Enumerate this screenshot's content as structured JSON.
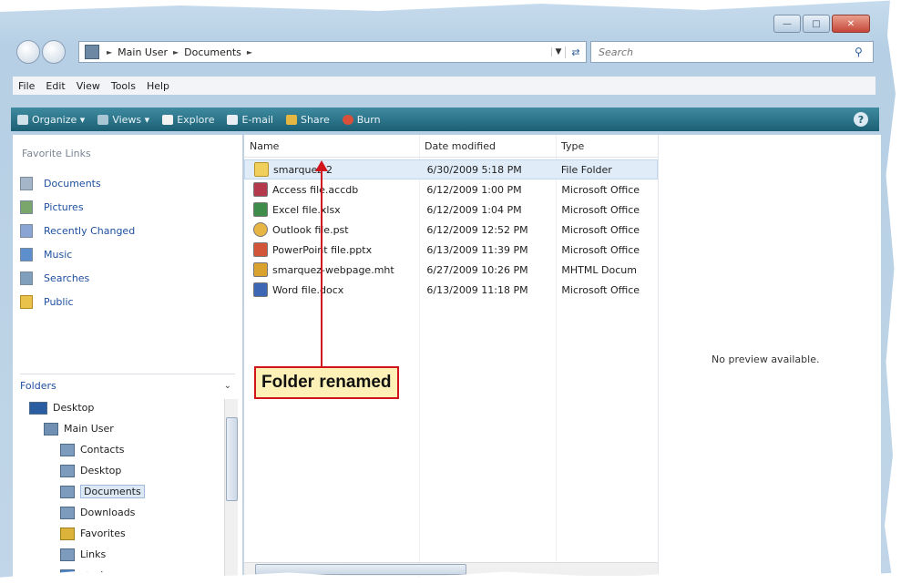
{
  "address": {
    "crumbs": [
      "Main User",
      "Documents"
    ],
    "search_placeholder": "Search"
  },
  "menu": [
    "File",
    "Edit",
    "View",
    "Tools",
    "Help"
  ],
  "toolbar": {
    "organize": "Organize",
    "views": "Views",
    "explore": "Explore",
    "email": "E-mail",
    "share": "Share",
    "burn": "Burn"
  },
  "favorites": {
    "title": "Favorite Links",
    "items": [
      "Documents",
      "Pictures",
      "Recently Changed",
      "Music",
      "Searches",
      "Public"
    ]
  },
  "folders": {
    "title": "Folders",
    "tree": [
      "Desktop",
      "Main User",
      "Contacts",
      "Desktop",
      "Documents",
      "Downloads",
      "Favorites",
      "Links",
      "Music"
    ]
  },
  "columns": [
    "Name",
    "Date modified",
    "Type"
  ],
  "files": [
    {
      "name": "smarquez-2",
      "date": "6/30/2009 5:18 PM",
      "type": "File Folder"
    },
    {
      "name": "Access file.accdb",
      "date": "6/12/2009 1:00 PM",
      "type": "Microsoft Office"
    },
    {
      "name": "Excel file.xlsx",
      "date": "6/12/2009 1:04 PM",
      "type": "Microsoft Office"
    },
    {
      "name": "Outlook file.pst",
      "date": "6/12/2009 12:52 PM",
      "type": "Microsoft Office"
    },
    {
      "name": "PowerPoint file.pptx",
      "date": "6/13/2009 11:39 PM",
      "type": "Microsoft Office"
    },
    {
      "name": "smarquez-webpage.mht",
      "date": "6/27/2009 10:26 PM",
      "type": "MHTML Docum"
    },
    {
      "name": "Word file.docx",
      "date": "6/13/2009 11:18 PM",
      "type": "Microsoft Office"
    }
  ],
  "preview": "No preview available.",
  "callout": "Folder renamed",
  "colors": {
    "toolbar": "#2a7186",
    "callout_border": "#d2141c",
    "callout_fill": "#fdf1b7",
    "link": "#1f4fa0"
  }
}
